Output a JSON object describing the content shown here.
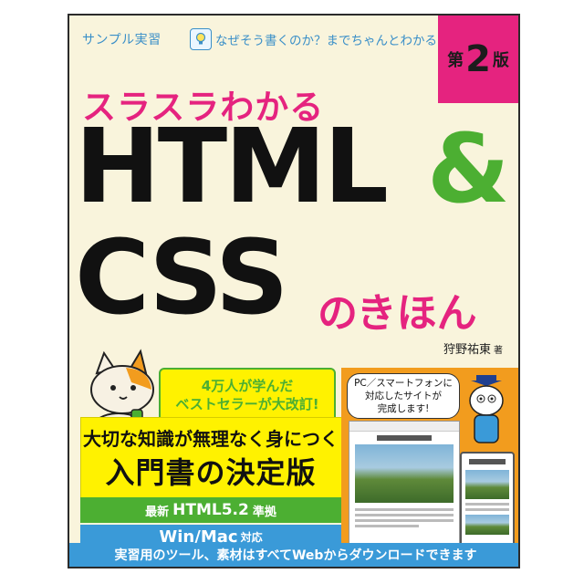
{
  "cover": {
    "sample_label": "サンプル実習",
    "tip_text": "なぜそう書くのか？までちゃんとわかる",
    "edition": {
      "prefix": "第",
      "number": "2",
      "suffix": "版"
    },
    "subtitle": "スラスラわかる",
    "title_line1": "HTML",
    "ampersand": "&",
    "title_line2": "CSS",
    "title_suffix": "のきほん",
    "author": "狩野祐東",
    "author_role": "著",
    "bestseller": {
      "line1": "4万人が学んだ",
      "line2": "ベストセラーが大改訂!"
    },
    "tagline": "大切な知識が無理なく身につく",
    "decisive": "入門書の決定版",
    "html_version": {
      "prefix": "最新",
      "name": "HTML5.2",
      "suffix": "準拠"
    },
    "platform": {
      "name": "Win/Mac",
      "suffix": "対応"
    },
    "speech": {
      "line1": "PC／スマートフォンに",
      "line2": "対応したサイトが",
      "line3": "完成します!"
    },
    "bottom_text": "実習用のツール、素材はすべてWebからダウンロードできます"
  },
  "colors": {
    "background": "#f9f4dc",
    "magenta": "#e5237f",
    "green": "#4caf32",
    "blue": "#3a9ad8",
    "yellow": "#fff200",
    "orange": "#f29c1e"
  },
  "icons": [
    "lightbulb-icon",
    "cat-illustration",
    "mascot-illustration"
  ]
}
